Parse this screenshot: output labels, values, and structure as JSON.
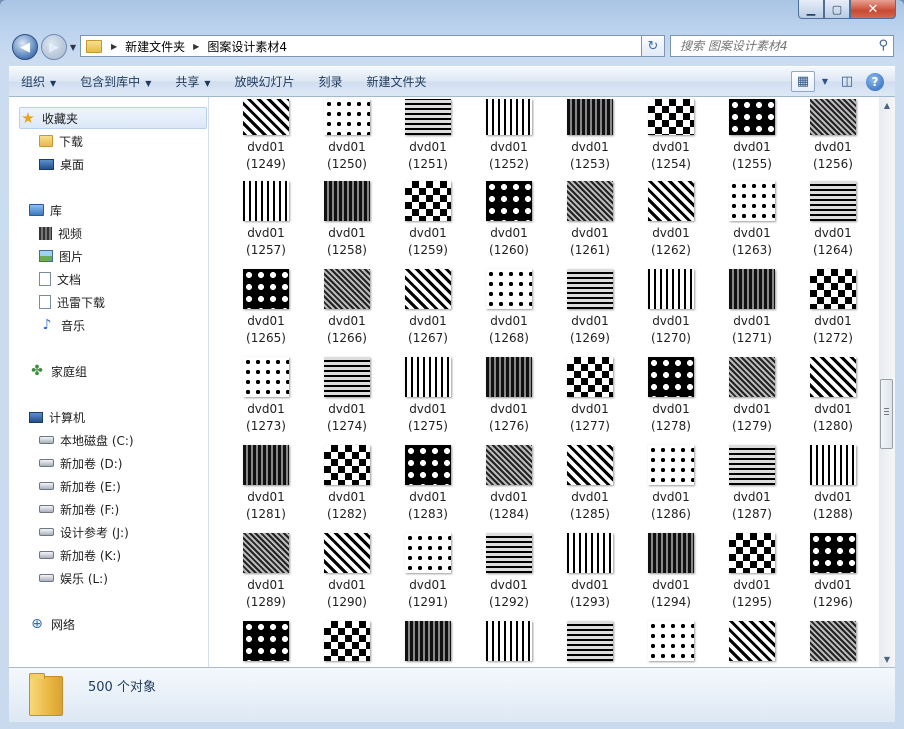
{
  "window": {
    "caption_buttons": [
      "minimize",
      "maximize",
      "close"
    ]
  },
  "address": {
    "crumbs": [
      "新建文件夹",
      "图案设计素材4"
    ]
  },
  "search": {
    "placeholder": "搜索 图案设计素材4"
  },
  "toolbar": {
    "items": [
      {
        "label": "组织",
        "dropdown": true
      },
      {
        "label": "包含到库中",
        "dropdown": true
      },
      {
        "label": "共享",
        "dropdown": true
      },
      {
        "label": "放映幻灯片",
        "dropdown": false
      },
      {
        "label": "刻录",
        "dropdown": false
      },
      {
        "label": "新建文件夹",
        "dropdown": false
      }
    ],
    "right_icons": [
      "view-options-icon",
      "preview-pane-icon",
      "help-icon"
    ]
  },
  "nav": {
    "favorites": {
      "label": "收藏夹",
      "items": [
        "下载",
        "桌面"
      ]
    },
    "libraries": {
      "label": "库",
      "items": [
        "视频",
        "图片",
        "文档",
        "迅雷下载",
        "音乐"
      ]
    },
    "homegroup": {
      "label": "家庭组"
    },
    "computer": {
      "label": "计算机",
      "items": [
        "本地磁盘 (C:)",
        "新加卷 (D:)",
        "新加卷 (E:)",
        "新加卷 (F:)",
        "设计参考 (J:)",
        "新加卷 (K:)",
        "娱乐 (L:)"
      ]
    },
    "network": {
      "label": "网络"
    }
  },
  "files": {
    "name_prefix": "dvd01",
    "visible_names": [
      "(1249)",
      "(1250)",
      "(1251)",
      "(1252)",
      "(1253)",
      "(1254)",
      "(1255)",
      "(1256)",
      "(1257)",
      "(1258)",
      "(1259)",
      "(1260)",
      "(1261)",
      "(1262)",
      "(1263)",
      "(1264)",
      "(1265)",
      "(1266)",
      "(1267)",
      "(1268)",
      "(1269)",
      "(1270)",
      "(1271)",
      "(1272)",
      "(1273)",
      "(1274)",
      "(1275)",
      "(1276)",
      "(1277)",
      "(1278)",
      "(1279)",
      "(1280)",
      "(1281)",
      "(1282)",
      "(1283)",
      "(1284)",
      "(1285)",
      "(1286)",
      "(1287)",
      "(1288)",
      "(1289)",
      "(1290)",
      "(1291)",
      "(1292)",
      "(1293)",
      "(1294)",
      "(1295)",
      "(1296)"
    ]
  },
  "status": {
    "count": "500 个对象"
  }
}
